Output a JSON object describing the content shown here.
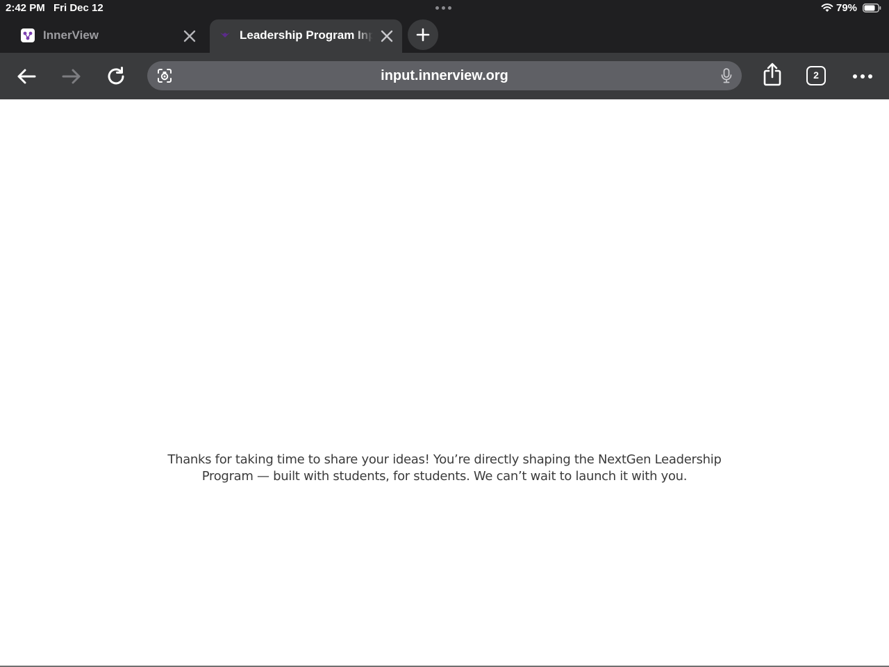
{
  "status_bar": {
    "time": "2:42 PM",
    "date": "Fri Dec 12",
    "battery_percent": "79%",
    "battery_level": 0.79
  },
  "tabs": [
    {
      "title": "InnerView",
      "active": false,
      "favicon": "innerview-logo-icon"
    },
    {
      "title": "Leadership Program Input",
      "active": true,
      "favicon": "innerview-logo-icon"
    }
  ],
  "toolbar": {
    "url": "input.innerview.org",
    "tab_count": "2"
  },
  "page": {
    "message": "Thanks for taking  time to share your ideas! You’re directly shaping the NextGen Leadership Program — built with students, for students. We can’t wait to launch it with you."
  },
  "colors": {
    "chrome_dark": "#1f1f21",
    "chrome_toolbar": "#3a3b3d",
    "omnibox": "#5f6065",
    "brand_purple": "#7b3fb0"
  }
}
